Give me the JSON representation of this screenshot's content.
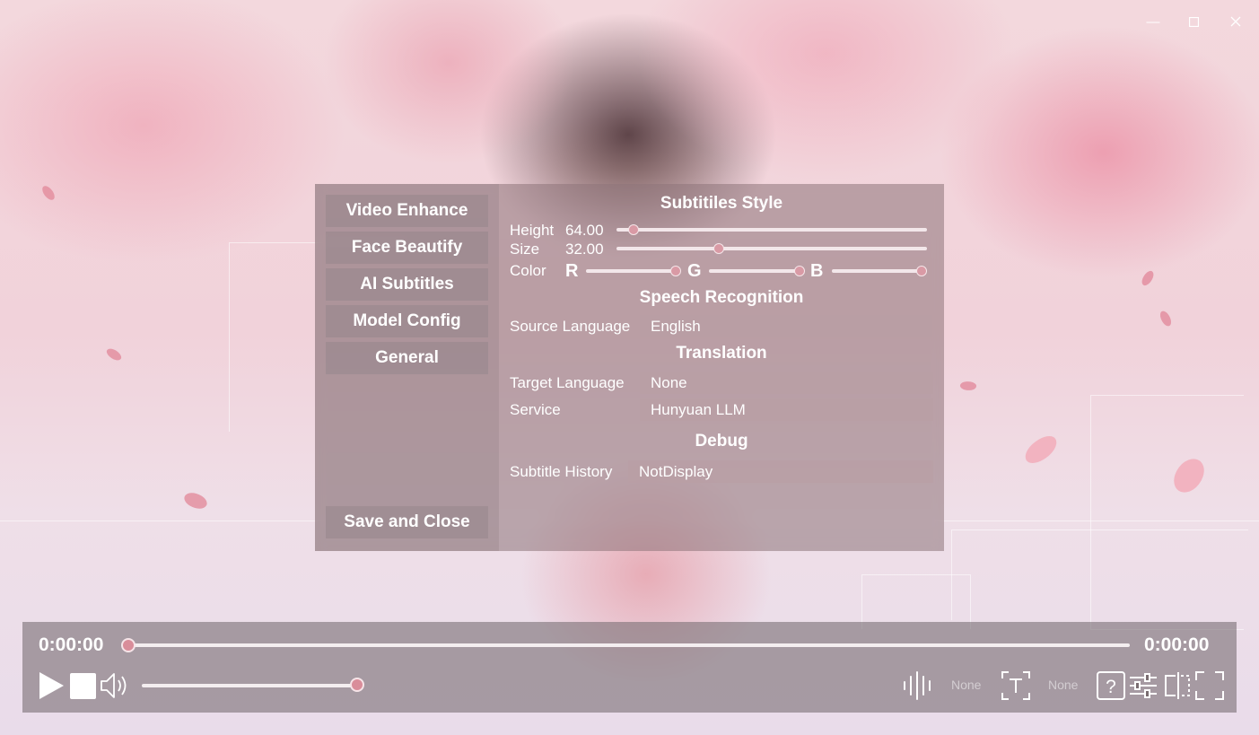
{
  "window": {
    "controls": {
      "minimize": "minimize-icon",
      "maximize": "maximize-icon",
      "close": "close-icon"
    }
  },
  "sidebar": {
    "items": [
      {
        "label": "Video Enhance"
      },
      {
        "label": "Face Beautify"
      },
      {
        "label": "AI Subtitles"
      },
      {
        "label": "Model Config"
      },
      {
        "label": "General"
      }
    ],
    "save_label": "Save and Close"
  },
  "subtitles_style": {
    "title": "Subtitiles Style",
    "height_label": "Height",
    "height_value": "64.00",
    "size_label": "Size",
    "size_value": "32.00",
    "color_label": "Color",
    "r_label": "R",
    "g_label": "G",
    "b_label": "B"
  },
  "speech": {
    "title": "Speech Recognition",
    "source_label": "Source Language",
    "source_value": "English"
  },
  "translation": {
    "title": "Translation",
    "target_label": "Target Language",
    "target_value": "None",
    "service_label": "Service",
    "service_value": "Hunyuan LLM"
  },
  "debug": {
    "title": "Debug",
    "history_label": "Subtitle History",
    "history_value": "NotDisplay"
  },
  "player": {
    "current_time": "0:00:00",
    "total_time": "0:00:00",
    "progress_fraction": 0.0,
    "volume_fraction": 1.0,
    "audio_track": "None",
    "subtitle_track": "None"
  },
  "colors": {
    "accent": "#d98d9a",
    "panel": "#8c7378"
  }
}
